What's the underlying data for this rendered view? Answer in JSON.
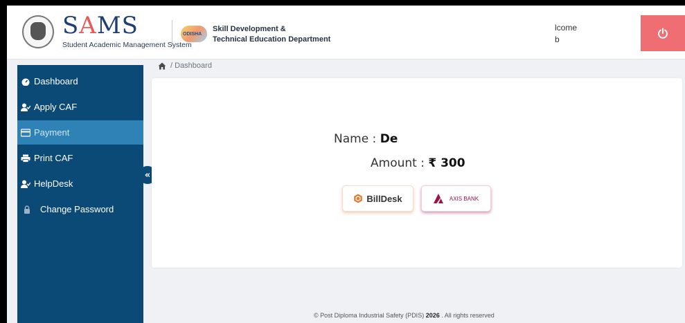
{
  "header": {
    "brand_prefix": "S",
    "brand_accent": "A",
    "brand_suffix": "MS",
    "brand_subtitle": "Student Academic Management System",
    "dept_line1": "Skill Development &",
    "dept_line2": "Technical Education Department",
    "welcome_text": "lcome",
    "welcome_user": "b",
    "logout_icon": "power-icon"
  },
  "sidebar": {
    "items": [
      {
        "label": "Dashboard",
        "icon": "dashboard-icon"
      },
      {
        "label": "Apply CAF",
        "icon": "user-check-icon"
      },
      {
        "label": "Payment",
        "icon": "credit-card-icon",
        "active": true
      },
      {
        "label": "Print CAF",
        "icon": "printer-icon"
      },
      {
        "label": "HelpDesk",
        "icon": "user-check-icon"
      },
      {
        "label": "Change Password",
        "icon": "lock-icon"
      }
    ],
    "collapse_label": "«"
  },
  "breadcrumb": {
    "separator": "/",
    "current": "Dashboard"
  },
  "payment": {
    "name_label": "Name : ",
    "name_value": "De",
    "amount_label": "Amount : ",
    "amount_value": "₹ 300",
    "gateways": [
      {
        "label": "BillDesk",
        "icon": "billdesk-icon"
      },
      {
        "label": "AXIS BANK",
        "icon": "axis-bank-icon"
      }
    ]
  },
  "footer": {
    "prefix": "© Post Diploma Industrial Safety (PDIS) ",
    "year": "2026",
    "suffix": " . All rights reserved"
  },
  "colors": {
    "sidebar_bg": "#0b4a76",
    "sidebar_active": "#2f82b6",
    "logout_bg": "#ee6e73",
    "brand_blue": "#1f3f74",
    "brand_red": "#e85a57"
  }
}
